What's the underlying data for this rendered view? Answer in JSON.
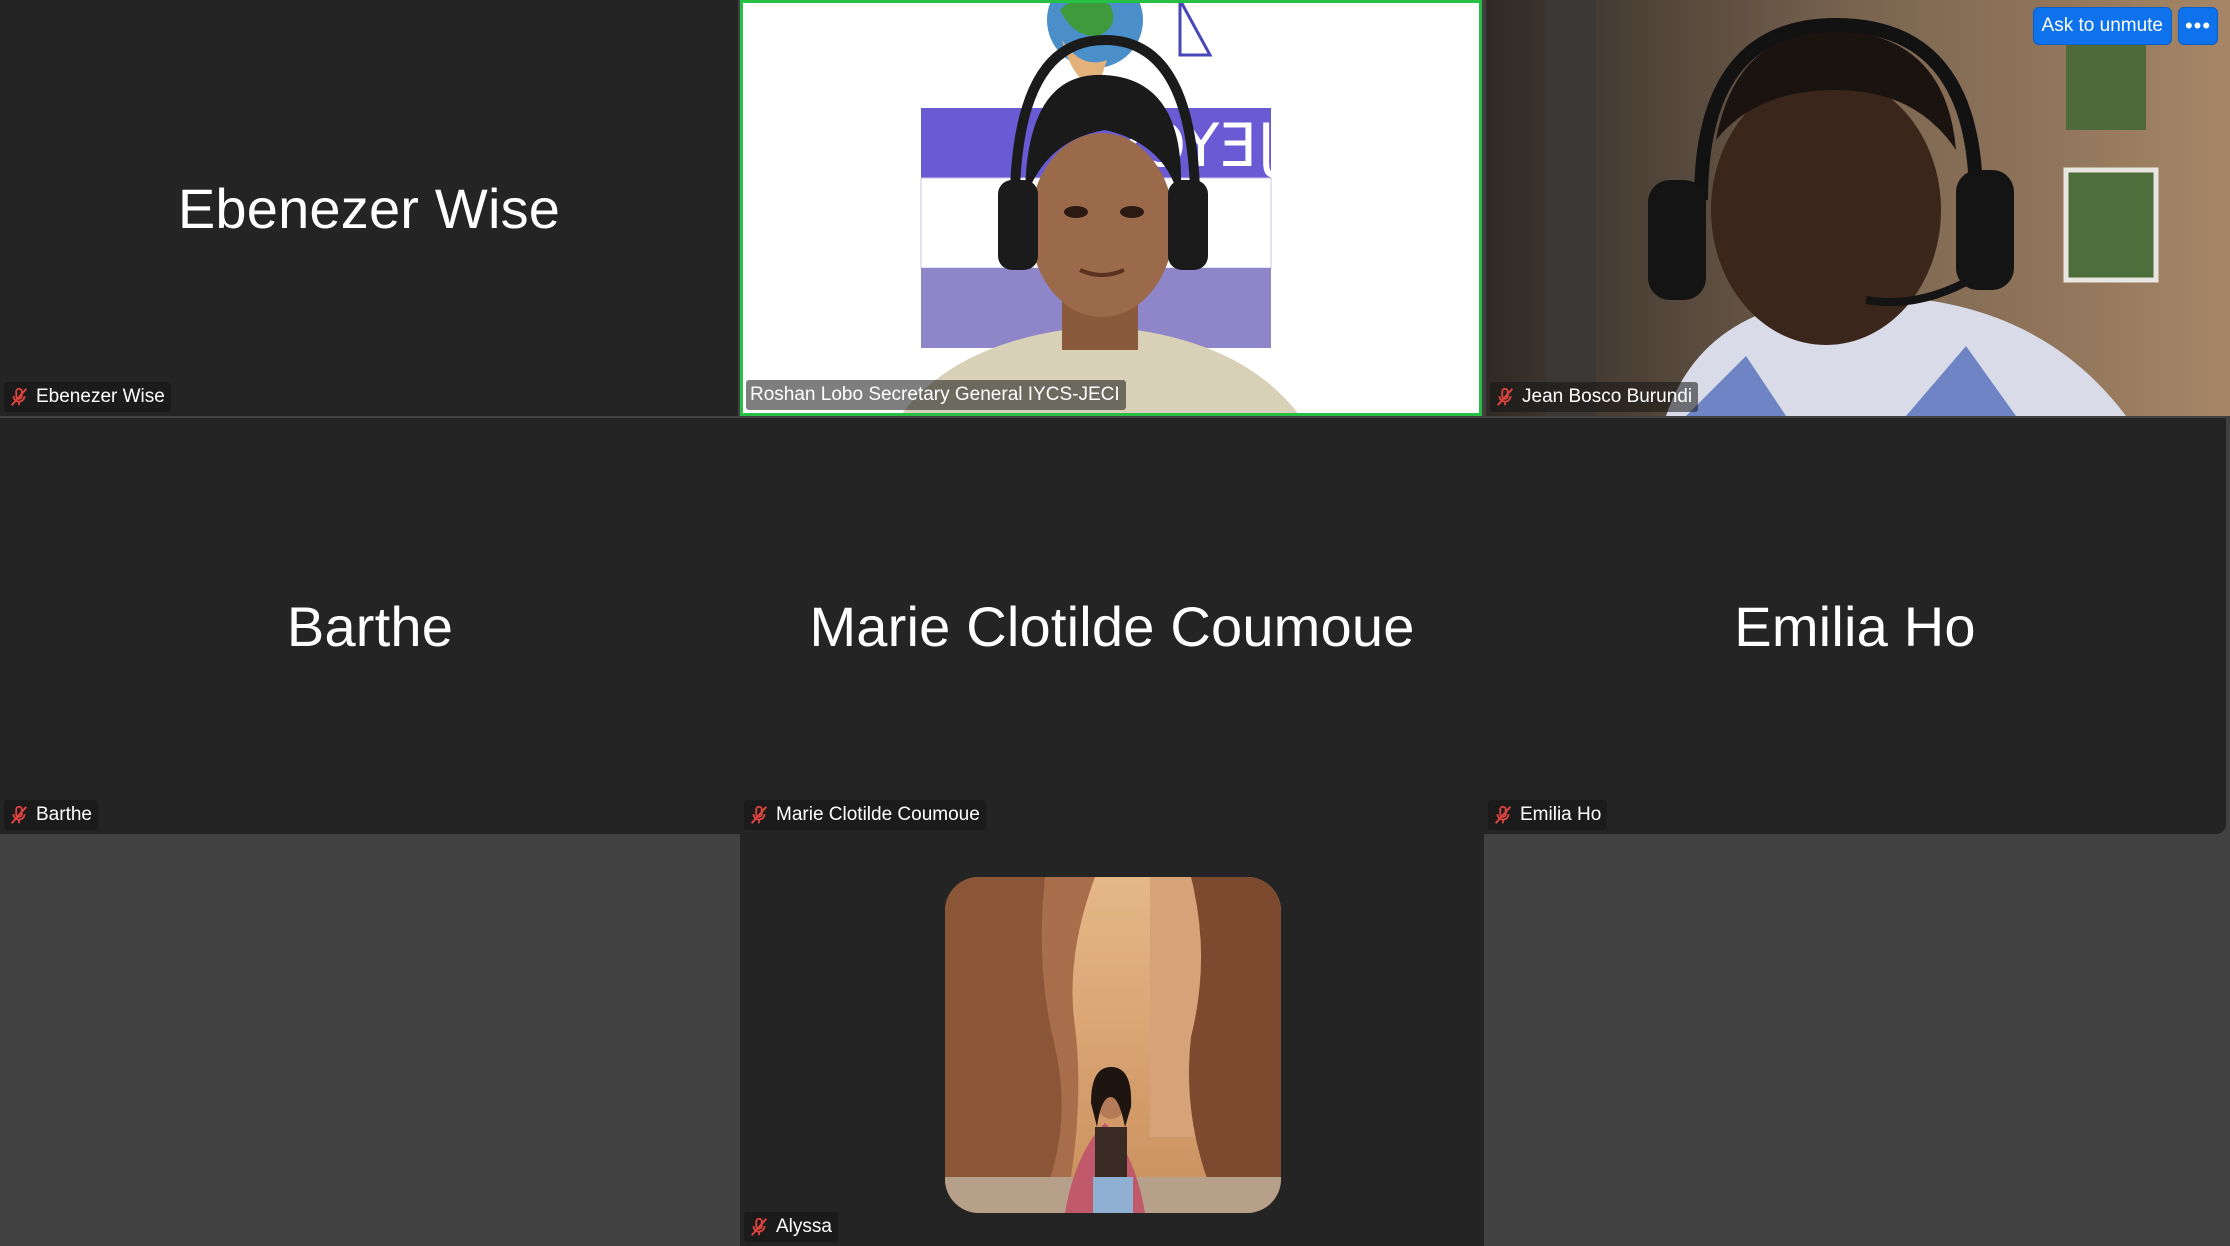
{
  "participants": [
    {
      "display_name": "Ebenezer Wise",
      "label": "Ebenezer Wise",
      "muted": true,
      "video": false
    },
    {
      "display_name": "Roshan Lobo Secretary General IYCS-JECI",
      "label": "Roshan Lobo Secretary General IYCS-JECI",
      "muted": false,
      "video": true,
      "active_speaker": true
    },
    {
      "display_name": "Jean Bosco Burundi",
      "label": "Jean Bosco Burundi",
      "muted": true,
      "video": true
    },
    {
      "display_name": "Barthe",
      "label": "Barthe",
      "muted": true,
      "video": false
    },
    {
      "display_name": "Marie Clotilde Coumoue",
      "label": "Marie Clotilde Coumoue",
      "muted": true,
      "video": false
    },
    {
      "display_name": "Emilia Ho",
      "label": "Emilia Ho",
      "muted": true,
      "video": false
    },
    {
      "display_name": "Alyssa",
      "label": "Alyssa",
      "muted": true,
      "video": false,
      "profile_photo": true
    }
  ],
  "controls": {
    "ask_to_unmute": "Ask to unmute",
    "more_label": "•••"
  },
  "colors": {
    "tile_bg": "#242424",
    "page_bg": "#414141",
    "active_speaker_border": "#27c044",
    "accent_blue": "#0e72ed",
    "muted_icon": "#e0443e"
  },
  "icons": {
    "muted_mic": "muted-mic-icon",
    "more": "more-options-icon"
  }
}
